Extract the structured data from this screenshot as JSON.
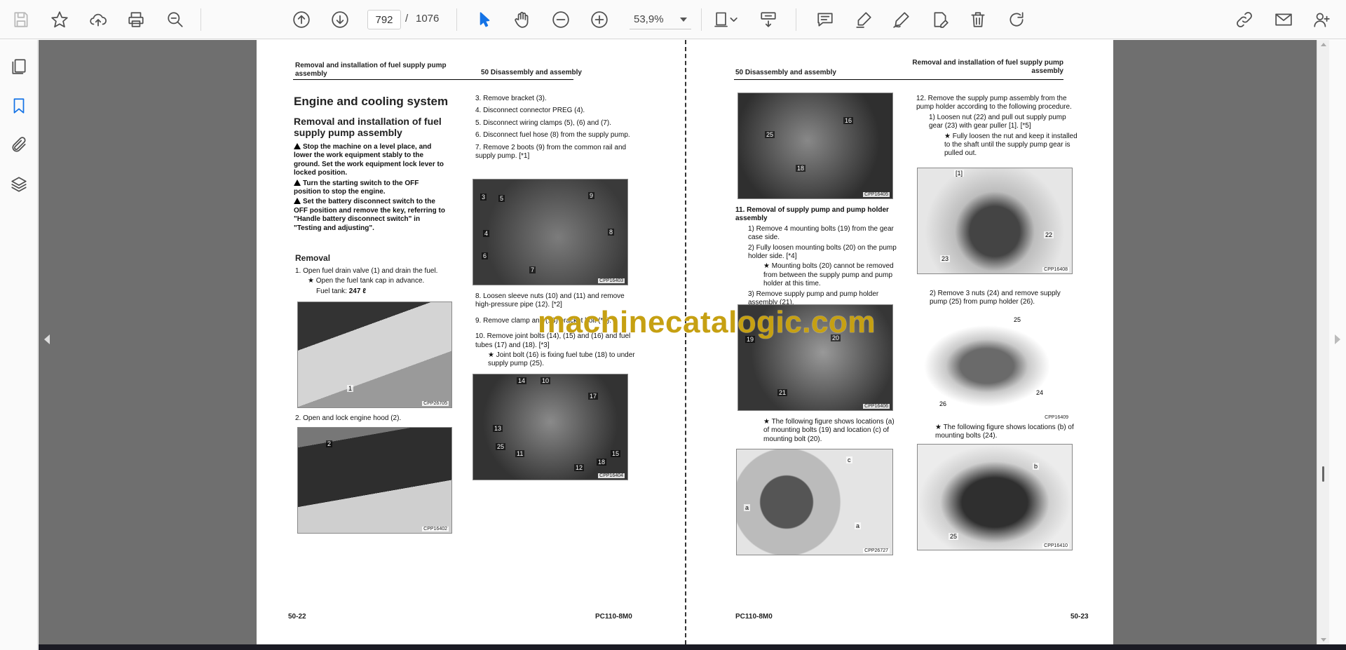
{
  "toolbar": {
    "page_current": "792",
    "page_separator": "/",
    "page_total": "1076",
    "zoom": "53,9%"
  },
  "icons": [
    "save-icon",
    "star-icon",
    "upload-icon",
    "print-icon",
    "zoom-search-icon",
    "page-up-icon",
    "page-down-icon",
    "select-cursor-icon",
    "hand-icon",
    "zoom-out-icon",
    "zoom-in-icon",
    "fit-page-icon",
    "scroll-mode-icon",
    "comment-icon",
    "highlight-icon",
    "sign-icon",
    "edit-icon",
    "delete-icon",
    "rotate-icon",
    "share-link-icon",
    "email-icon",
    "add-user-icon",
    "thumbnails-icon",
    "bookmark-icon",
    "attachment-icon",
    "layers-icon"
  ],
  "left_page": {
    "header_left": "Removal and installation of fuel supply pump assembly",
    "header_right": "50 Disassembly and assembly",
    "section_title": "Engine and cooling system",
    "subtitle": "Removal and installation of fuel supply pump assembly",
    "warnings": [
      "Stop the machine on a level place, and lower the work equipment stably to the ground. Set the work equipment lock lever to locked position.",
      "Turn the starting switch to the OFF position to stop the engine.",
      "Set the battery disconnect switch to the OFF position and remove the key, referring to \"Handle battery disconnect switch\" in \"Testing and adjusting\"."
    ],
    "removal_heading": "Removal",
    "step1": "1.   Open fuel drain valve (1) and drain the fuel.",
    "step1_note": "★   Open the fuel tank cap in advance.",
    "fuel_label": "Fuel tank:",
    "fuel_value": "247 ℓ",
    "step2": "2.   Open and lock engine hood (2).",
    "img1_code": "CPP26705",
    "img2_code": "CPP16402",
    "steps_col2": [
      "3.   Remove bracket (3).",
      "4.   Disconnect connector PREG (4).",
      "5.   Disconnect wiring clamps (5), (6) and (7).",
      "6.   Disconnect fuel hose (8) from the supply pump.",
      "7.   Remove 2 boots (9) from the common rail and supply pump. [*1]"
    ],
    "img3_code": "CPP16403",
    "steps_col2b": [
      "8.   Loosen sleeve nuts (10) and (11) and remove high-pressure pipe (12). [*2]",
      "9.   Remove clamp and (13) bracket bolt (*1).",
      "10. Remove joint bolts (14), (15) and (16) and fuel tubes (17) and (18). [*3]",
      "★   Joint bolt (16) is fixing fuel tube (18) to under supply pump (25)."
    ],
    "img4_code": "CPP16404",
    "footer_left": "50-22",
    "footer_right": "PC110-8M0"
  },
  "right_page": {
    "header_left": "50 Disassembly and assembly",
    "header_right": "Removal and installation of fuel supply pump assembly",
    "img5_code": "CPP16405",
    "step11": "11. Removal of supply pump and pump holder assembly",
    "step11_items": [
      "1)   Remove 4 mounting bolts (19) from the gear case side.",
      "2)   Fully loosen mounting bolts (20) on the pump holder side. [*4]",
      "★   Mounting bolts (20) cannot be removed from between the supply pump and pump holder at this time.",
      "3)   Remove supply pump and pump holder assembly (21)."
    ],
    "img6_code": "CPP16406",
    "note_a": "★   The following figure shows locations (a) of mounting bolts (19) and location (c) of mounting bolt (20).",
    "img7_code": "CPP26727",
    "step12": "12. Remove the supply pump assembly from the pump holder according to the following procedure.",
    "step12_items": [
      "1)   Loosen nut (22) and pull out supply pump gear (23) with gear puller [1]. [*5]",
      "★   Fully loosen the nut and keep it installed to the shaft until the supply pump gear is pulled out."
    ],
    "img8_code": "CPP16408",
    "step12_2": "2)   Remove 3 nuts (24) and remove supply pump (25) from pump holder (26).",
    "img9_code": "CPP16409",
    "note_b": "★   The following figure shows locations (b) of mounting bolts (24).",
    "img10_code": "CPP16410",
    "footer_left": "PC110-8M0",
    "footer_right": "50-23"
  },
  "watermark": "machinecatalogic.com"
}
